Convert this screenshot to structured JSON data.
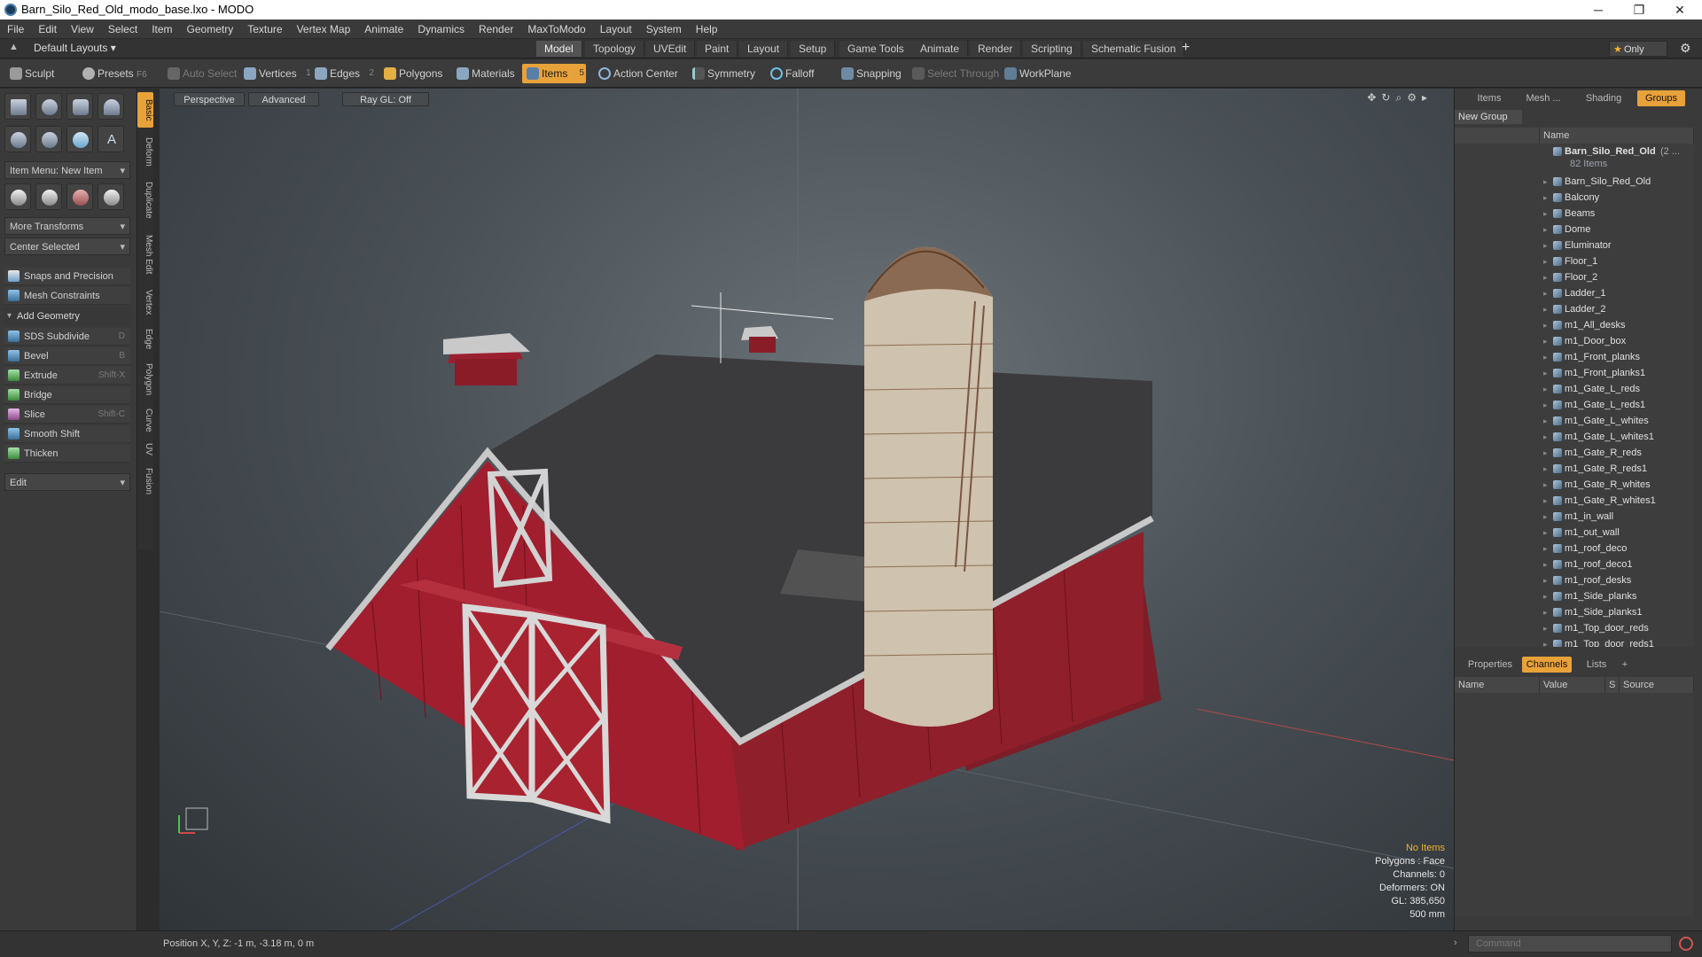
{
  "window": {
    "title": "Barn_Silo_Red_Old_modo_base.lxo - MODO",
    "minimize": "─",
    "maximize": "❐",
    "close": "✕"
  },
  "menu": [
    "File",
    "Edit",
    "View",
    "Select",
    "Item",
    "Geometry",
    "Texture",
    "Vertex Map",
    "Animate",
    "Dynamics",
    "Render",
    "MaxToModo",
    "Layout",
    "System",
    "Help"
  ],
  "layoutbar": {
    "layouts_label": "Default Layouts",
    "tabs": [
      "Model",
      "Topology",
      "UVEdit",
      "Paint",
      "Layout",
      "Setup",
      "Game Tools",
      "Animate",
      "Render",
      "Scripting",
      "Schematic Fusion"
    ],
    "active_tab": "Model",
    "add": "+",
    "only_label": "Only"
  },
  "toolbar": {
    "sculpt": "Sculpt",
    "presets": "Presets",
    "presets_key": "F6",
    "auto_select": "Auto Select",
    "vertices": "Vertices",
    "vertices_count": "1",
    "edges": "Edges",
    "edges_count": "2",
    "polygons": "Polygons",
    "materials": "Materials",
    "items": "Items",
    "items_count": "5",
    "action_center": "Action Center",
    "symmetry": "Symmetry",
    "falloff": "Falloff",
    "snapping": "Snapping",
    "select_through": "Select Through",
    "workplane": "WorkPlane"
  },
  "left_panel": {
    "item_menu": "Item Menu: New Item",
    "more_transforms": "More Transforms",
    "center_selected": "Center Selected",
    "snaps": "Snaps and Precision",
    "mesh_constraints": "Mesh Constraints",
    "add_geometry": "Add Geometry",
    "tools": [
      {
        "label": "SDS Subdivide",
        "shortcut": "D"
      },
      {
        "label": "Bevel",
        "shortcut": "B"
      },
      {
        "label": "Extrude",
        "shortcut": "Shift-X"
      },
      {
        "label": "Bridge",
        "shortcut": ""
      },
      {
        "label": "Slice",
        "shortcut": "Shift-C"
      },
      {
        "label": "Smooth Shift",
        "shortcut": ""
      },
      {
        "label": "Thicken",
        "shortcut": ""
      }
    ],
    "edit": "Edit",
    "vertical_tabs": [
      "Basic",
      "Deform",
      "Duplicate",
      "Mesh Edit",
      "Vertex",
      "Edge",
      "Polygon",
      "Curve",
      "UV",
      "Fusion"
    ]
  },
  "viewport": {
    "perspective": "Perspective",
    "advanced": "Advanced",
    "raygl": "Ray GL: Off",
    "info": {
      "no_items": "No Items",
      "polygons": "Polygons : Face",
      "channels": "Channels: 0",
      "deformers": "Deformers: ON",
      "gl": "GL: 385,650",
      "scale": "500 mm"
    }
  },
  "right_panel": {
    "tabs": [
      "Items",
      "Mesh ...",
      "Shading",
      "Groups"
    ],
    "active_tab": "Groups",
    "new_group": "New Group",
    "name_header": "Name",
    "group_name": "Barn_Silo_Red_Old",
    "group_suffix": "(2 ...",
    "group_count": "82 Items",
    "items": [
      "Barn_Silo_Red_Old",
      "Balcony",
      "Beams",
      "Dome",
      "Eluminator",
      "Floor_1",
      "Floor_2",
      "Ladder_1",
      "Ladder_2",
      "m1_All_desks",
      "m1_Door_box",
      "m1_Front_planks",
      "m1_Front_planks1",
      "m1_Gate_L_reds",
      "m1_Gate_L_reds1",
      "m1_Gate_L_whites",
      "m1_Gate_L_whites1",
      "m1_Gate_R_reds",
      "m1_Gate_R_reds1",
      "m1_Gate_R_whites",
      "m1_Gate_R_whites1",
      "m1_in_wall",
      "m1_out_wall",
      "m1_roof_deco",
      "m1_roof_deco1",
      "m1_roof_desks",
      "m1_Side_planks",
      "m1_Side_planks1",
      "m1_Top_door_reds",
      "m1_Top_door_reds1"
    ],
    "bottom_tabs": [
      "Properties",
      "Channels",
      "Lists",
      "+"
    ],
    "bottom_active": "Channels",
    "columns": [
      "Name",
      "Value",
      "S",
      "Source"
    ]
  },
  "status": {
    "position": "Position X, Y, Z:  -1 m, -3.18 m, 0 m",
    "command_placeholder": "Command"
  }
}
